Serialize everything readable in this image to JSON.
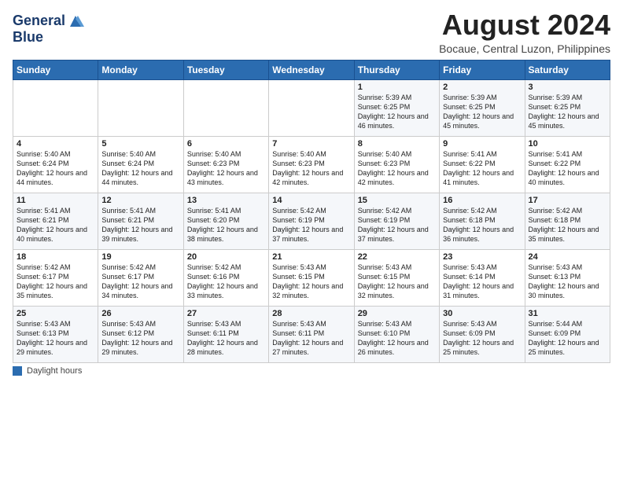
{
  "logo": {
    "line1": "General",
    "line2": "Blue"
  },
  "title": "August 2024",
  "subtitle": "Bocaue, Central Luzon, Philippines",
  "days_of_week": [
    "Sunday",
    "Monday",
    "Tuesday",
    "Wednesday",
    "Thursday",
    "Friday",
    "Saturday"
  ],
  "weeks": [
    [
      {
        "day": "",
        "info": ""
      },
      {
        "day": "",
        "info": ""
      },
      {
        "day": "",
        "info": ""
      },
      {
        "day": "",
        "info": ""
      },
      {
        "day": "1",
        "info": "Sunrise: 5:39 AM\nSunset: 6:25 PM\nDaylight: 12 hours\nand 46 minutes."
      },
      {
        "day": "2",
        "info": "Sunrise: 5:39 AM\nSunset: 6:25 PM\nDaylight: 12 hours\nand 45 minutes."
      },
      {
        "day": "3",
        "info": "Sunrise: 5:39 AM\nSunset: 6:25 PM\nDaylight: 12 hours\nand 45 minutes."
      }
    ],
    [
      {
        "day": "4",
        "info": "Sunrise: 5:40 AM\nSunset: 6:24 PM\nDaylight: 12 hours\nand 44 minutes."
      },
      {
        "day": "5",
        "info": "Sunrise: 5:40 AM\nSunset: 6:24 PM\nDaylight: 12 hours\nand 44 minutes."
      },
      {
        "day": "6",
        "info": "Sunrise: 5:40 AM\nSunset: 6:23 PM\nDaylight: 12 hours\nand 43 minutes."
      },
      {
        "day": "7",
        "info": "Sunrise: 5:40 AM\nSunset: 6:23 PM\nDaylight: 12 hours\nand 42 minutes."
      },
      {
        "day": "8",
        "info": "Sunrise: 5:40 AM\nSunset: 6:23 PM\nDaylight: 12 hours\nand 42 minutes."
      },
      {
        "day": "9",
        "info": "Sunrise: 5:41 AM\nSunset: 6:22 PM\nDaylight: 12 hours\nand 41 minutes."
      },
      {
        "day": "10",
        "info": "Sunrise: 5:41 AM\nSunset: 6:22 PM\nDaylight: 12 hours\nand 40 minutes."
      }
    ],
    [
      {
        "day": "11",
        "info": "Sunrise: 5:41 AM\nSunset: 6:21 PM\nDaylight: 12 hours\nand 40 minutes."
      },
      {
        "day": "12",
        "info": "Sunrise: 5:41 AM\nSunset: 6:21 PM\nDaylight: 12 hours\nand 39 minutes."
      },
      {
        "day": "13",
        "info": "Sunrise: 5:41 AM\nSunset: 6:20 PM\nDaylight: 12 hours\nand 38 minutes."
      },
      {
        "day": "14",
        "info": "Sunrise: 5:42 AM\nSunset: 6:19 PM\nDaylight: 12 hours\nand 37 minutes."
      },
      {
        "day": "15",
        "info": "Sunrise: 5:42 AM\nSunset: 6:19 PM\nDaylight: 12 hours\nand 37 minutes."
      },
      {
        "day": "16",
        "info": "Sunrise: 5:42 AM\nSunset: 6:18 PM\nDaylight: 12 hours\nand 36 minutes."
      },
      {
        "day": "17",
        "info": "Sunrise: 5:42 AM\nSunset: 6:18 PM\nDaylight: 12 hours\nand 35 minutes."
      }
    ],
    [
      {
        "day": "18",
        "info": "Sunrise: 5:42 AM\nSunset: 6:17 PM\nDaylight: 12 hours\nand 35 minutes."
      },
      {
        "day": "19",
        "info": "Sunrise: 5:42 AM\nSunset: 6:17 PM\nDaylight: 12 hours\nand 34 minutes."
      },
      {
        "day": "20",
        "info": "Sunrise: 5:42 AM\nSunset: 6:16 PM\nDaylight: 12 hours\nand 33 minutes."
      },
      {
        "day": "21",
        "info": "Sunrise: 5:43 AM\nSunset: 6:15 PM\nDaylight: 12 hours\nand 32 minutes."
      },
      {
        "day": "22",
        "info": "Sunrise: 5:43 AM\nSunset: 6:15 PM\nDaylight: 12 hours\nand 32 minutes."
      },
      {
        "day": "23",
        "info": "Sunrise: 5:43 AM\nSunset: 6:14 PM\nDaylight: 12 hours\nand 31 minutes."
      },
      {
        "day": "24",
        "info": "Sunrise: 5:43 AM\nSunset: 6:13 PM\nDaylight: 12 hours\nand 30 minutes."
      }
    ],
    [
      {
        "day": "25",
        "info": "Sunrise: 5:43 AM\nSunset: 6:13 PM\nDaylight: 12 hours\nand 29 minutes."
      },
      {
        "day": "26",
        "info": "Sunrise: 5:43 AM\nSunset: 6:12 PM\nDaylight: 12 hours\nand 29 minutes."
      },
      {
        "day": "27",
        "info": "Sunrise: 5:43 AM\nSunset: 6:11 PM\nDaylight: 12 hours\nand 28 minutes."
      },
      {
        "day": "28",
        "info": "Sunrise: 5:43 AM\nSunset: 6:11 PM\nDaylight: 12 hours\nand 27 minutes."
      },
      {
        "day": "29",
        "info": "Sunrise: 5:43 AM\nSunset: 6:10 PM\nDaylight: 12 hours\nand 26 minutes."
      },
      {
        "day": "30",
        "info": "Sunrise: 5:43 AM\nSunset: 6:09 PM\nDaylight: 12 hours\nand 25 minutes."
      },
      {
        "day": "31",
        "info": "Sunrise: 5:44 AM\nSunset: 6:09 PM\nDaylight: 12 hours\nand 25 minutes."
      }
    ]
  ],
  "footer": {
    "label": "Daylight hours"
  }
}
